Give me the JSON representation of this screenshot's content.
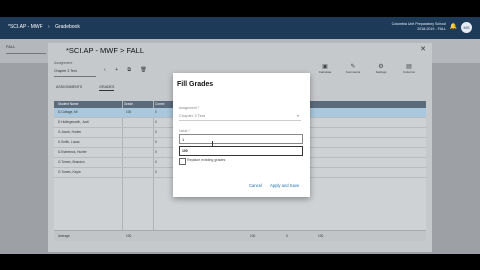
{
  "topbar": {
    "crumb_left": "*SCI.AP - MWF",
    "crumb_right": "Gradebook",
    "school": "Columbia Unit Preparatory School",
    "term": "2018-2019 - FALL",
    "avatar": "MS"
  },
  "subbar": {
    "selector": "FALL"
  },
  "gradebook": {
    "title": "*SCI.AP - MWF > FALL",
    "filter_label": "Assignment",
    "filter_value": "Chapter 3 Test",
    "tabs": [
      "ASSIGNMENTS",
      "GRADES"
    ],
    "toolbar_icons": [
      "Calculate",
      "Comments",
      "Settings",
      "Columns"
    ],
    "columns": [
      "Student Name",
      "Grade",
      "Comm"
    ],
    "students": [
      {
        "name": "D.Cottage, Mi",
        "grade": "100",
        "v": "0"
      },
      {
        "name": "D.Hollingsworth, Justi",
        "grade": "",
        "v": "0"
      },
      {
        "name": "G.Jacob, Hunter",
        "grade": "",
        "v": "0"
      },
      {
        "name": "K.Smith, Lucas",
        "grade": "",
        "v": "0"
      },
      {
        "name": "D.Esteemos, Hunter",
        "grade": "",
        "v": "0"
      },
      {
        "name": "G.Tomes, Brandon",
        "grade": "",
        "v": "0"
      },
      {
        "name": "G.Tomes, Kayla",
        "grade": "",
        "v": "0"
      }
    ],
    "average": {
      "label": "Average",
      "v1": "100",
      "v2": "100",
      "v3": "0",
      "v4": "100"
    }
  },
  "dialog": {
    "title": "Fill Grades",
    "assignment_label": "Assignment *",
    "assignment_value": "Chapter 3 Test",
    "value_label": "Value *",
    "value_input": "1",
    "value_typed": "100",
    "replace_label": "Replace existing grades",
    "cancel": "Cancel",
    "apply": "Apply and Save"
  }
}
